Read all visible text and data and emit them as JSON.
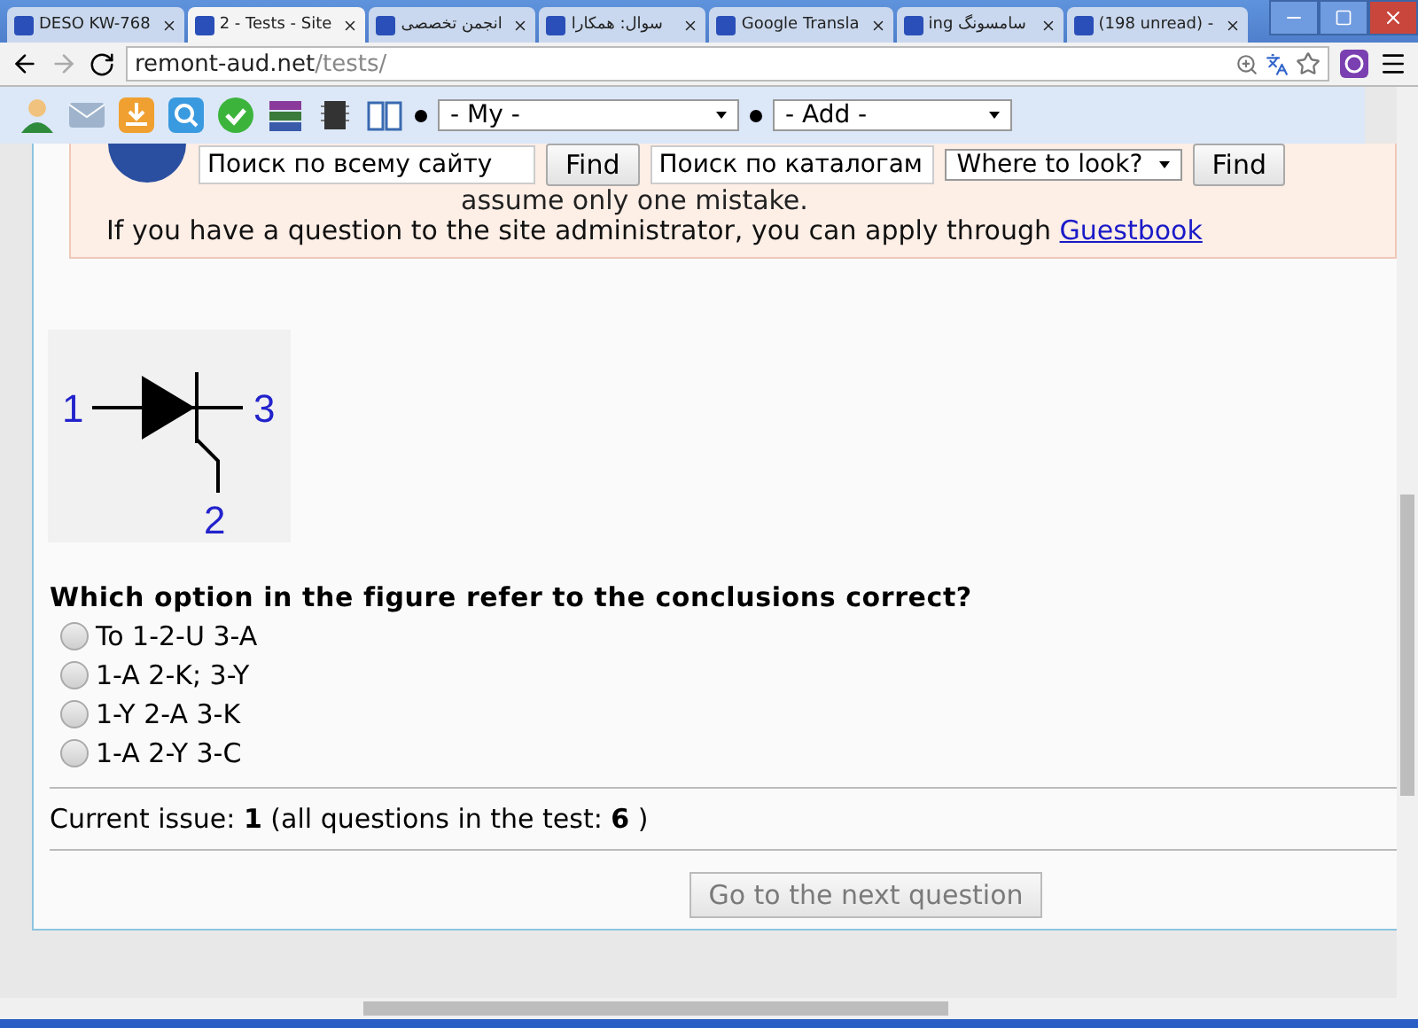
{
  "tabs": [
    {
      "label": "DESO KW-768",
      "selected": false
    },
    {
      "label": "2 - Tests - Site",
      "selected": true
    },
    {
      "label": "انجمن تخصصی",
      "selected": false
    },
    {
      "label": "سوال: همکارا",
      "selected": false
    },
    {
      "label": "Google Transla",
      "selected": false
    },
    {
      "label": "ing سامسونگ",
      "selected": false
    },
    {
      "label": "(198 unread) -",
      "selected": false
    }
  ],
  "address": {
    "host": "remont-aud.net",
    "path": "/tests/"
  },
  "toolbar": {
    "dropdowns": [
      "- My -",
      "- Add -"
    ]
  },
  "search": {
    "site_placeholder": "Поиск по всему сайту",
    "site_button": "Find",
    "catalog_placeholder": "Поиск по каталогам",
    "where": "Where to look?",
    "catalog_button": "Find"
  },
  "notice": {
    "fragment": "assume only one mistake.",
    "admin_text": "If you have a question to the site administrator, you can apply through",
    "link": "Guestbook"
  },
  "figure": {
    "labels": [
      "1",
      "3",
      "2"
    ]
  },
  "question": "Which option in the figure refer to the conclusions correct?",
  "options": [
    {
      "label": "To 1-2-U 3-A",
      "selected": false
    },
    {
      "label": "1-A 2-K; 3-Y",
      "selected": false
    },
    {
      "label": "1-Y 2-A 3-K",
      "selected": false
    },
    {
      "label": "1-A 2-Y 3-C",
      "selected": false
    }
  ],
  "status": "Current issue: **1** (all questions in the test: **6** )",
  "next_button": {
    "label": "Go to the next question",
    "disabled": true
  }
}
